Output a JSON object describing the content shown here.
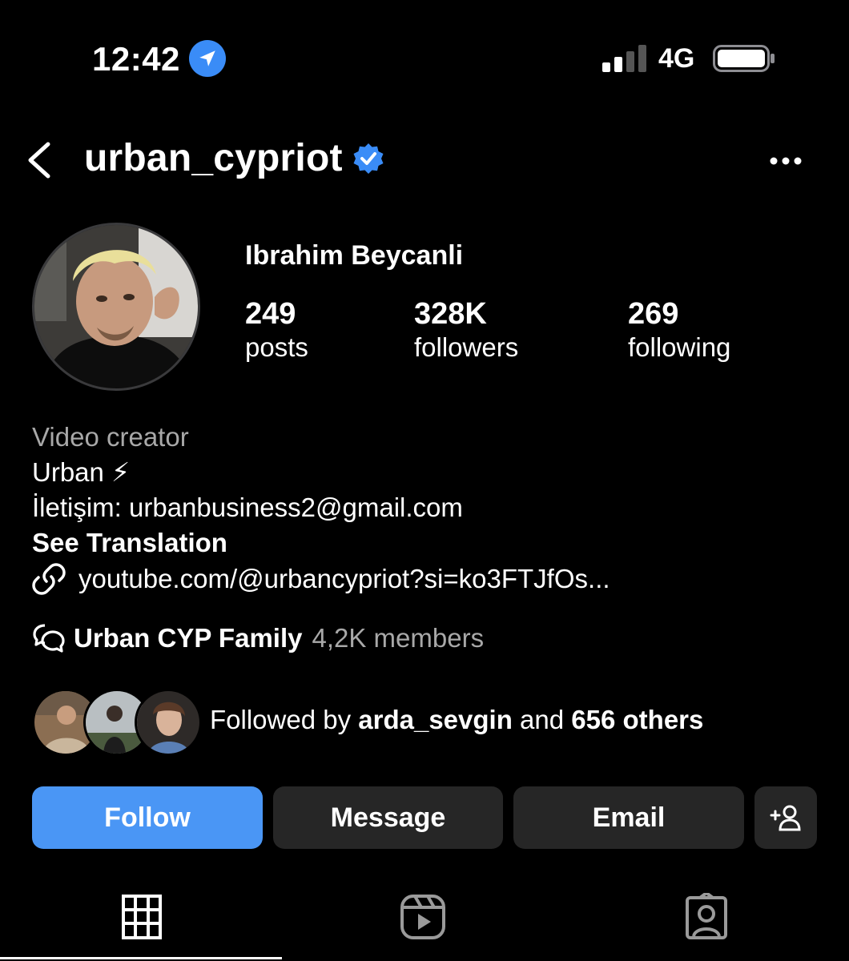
{
  "status_bar": {
    "time": "12:42",
    "network": "4G",
    "location_icon": "location-arrow-icon",
    "signal_icon": "signal-bars-icon",
    "battery_icon": "battery-icon"
  },
  "header": {
    "username": "urban_cypriot",
    "verified": true,
    "back_icon": "chevron-left-icon",
    "more_icon": "more-horizontal-icon"
  },
  "profile": {
    "full_name": "Ibrahim Beycanli",
    "stats": [
      {
        "value": "249",
        "label": "posts"
      },
      {
        "value": "328K",
        "label": "followers"
      },
      {
        "value": "269",
        "label": "following"
      }
    ]
  },
  "bio": {
    "category": "Video creator",
    "line1": "Urban ⚡",
    "line2": "İletişim: urbanbusiness2@gmail.com",
    "see_translation": "See Translation",
    "link": "youtube.com/@urbancypriot?si=ko3FTJfOs...",
    "channel_name": "Urban CYP Family",
    "channel_members": "4,2K members"
  },
  "followed_by": {
    "prefix": "Followed by",
    "user": "arda_sevgin",
    "middle": "and",
    "others": "656 others"
  },
  "actions": {
    "follow": "Follow",
    "message": "Message",
    "email": "Email",
    "add_icon": "add-person-icon"
  },
  "tabs": [
    {
      "icon": "grid-icon",
      "active": true
    },
    {
      "icon": "reels-icon",
      "active": false
    },
    {
      "icon": "tagged-icon",
      "active": false
    }
  ],
  "colors": {
    "background": "#000000",
    "accent": "#4a96f5",
    "verified": "#3a8cf7",
    "secondary_button": "#262626",
    "muted_text": "#a8a8a8"
  }
}
